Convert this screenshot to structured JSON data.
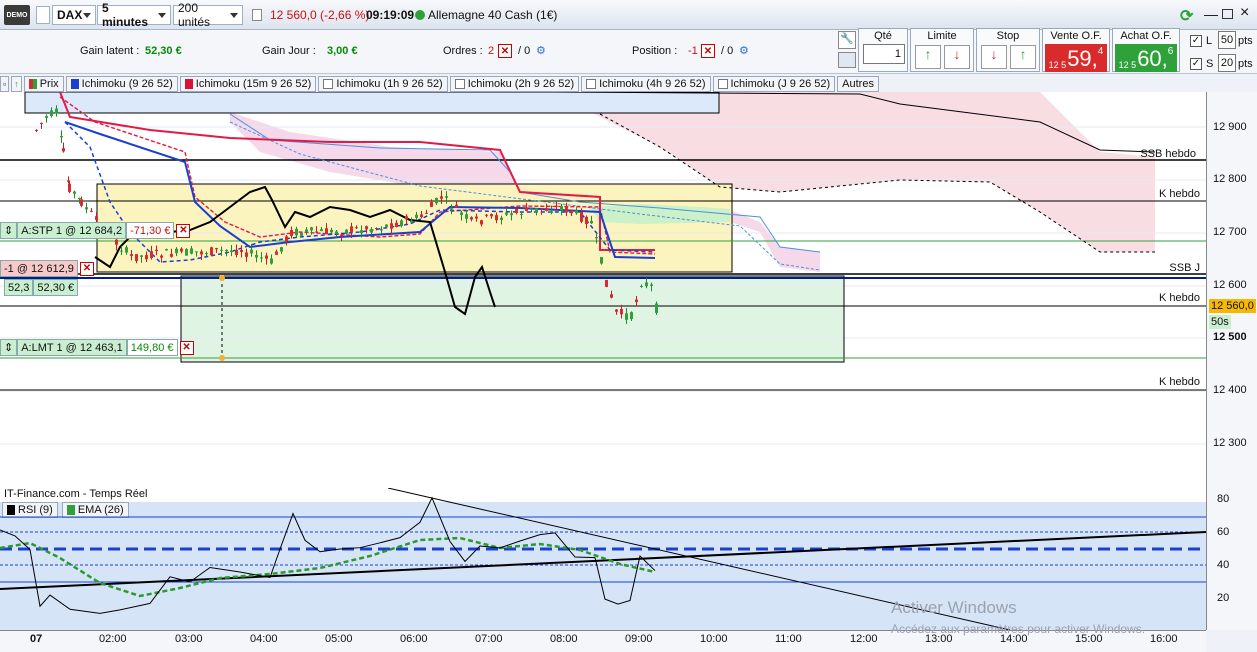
{
  "toolbar": {
    "demo_badge": "DEMO",
    "instrument": "DAX",
    "timeframe": "5 minutes",
    "units": "200 unités",
    "price_change": "12 560,0 (-2,66 %)",
    "time": "09:19:09",
    "market": "Allemagne 40 Cash (1€)"
  },
  "info": {
    "gain_latent_label": "Gain latent :",
    "gain_latent_value": "52,30 €",
    "gain_jour_label": "Gain Jour :",
    "gain_jour_value": "3,00 €",
    "ordres_label": "Ordres :",
    "ordres_count": "2",
    "ordres_zero": "/ 0",
    "position_label": "Position :",
    "position_value": "-1",
    "position_zero": "/ 0"
  },
  "order_panel": {
    "qte_label": "Qté",
    "qte_value": "1",
    "limite_label": "Limite",
    "stop_label": "Stop",
    "vente_label": "Vente O.F.",
    "vente_prefix": "12 5",
    "vente_big": "59,",
    "vente_small": "4",
    "achat_label": "Achat O.F.",
    "achat_prefix": "12 5",
    "achat_big": "60,",
    "achat_small": "6",
    "l_label": "L",
    "l_value": "50",
    "s_label": "S",
    "s_value": "20",
    "pts": "pts",
    "sell_color": "#d92b2b",
    "buy_color": "#2fa13a"
  },
  "legend": {
    "prix": "Prix",
    "items": [
      "Ichimoku (9 26 52)",
      "Ichimoku (15m 9 26 52)",
      "Ichimoku (1h 9 26 52)",
      "Ichimoku (2h 9 26 52)",
      "Ichimoku (4h 9 26 52)",
      "Ichimoku (J 9 26 52)"
    ],
    "autres": "Autres"
  },
  "orders": {
    "stp_label": "A:STP  1 @ 12 684,2",
    "stp_pnl": "-71,30 €",
    "pos_label": "-1 @ 12 612,9",
    "pos_pts": "52,3",
    "pos_pnl": "52,30 €",
    "lmt_label": "A:LMT  1 @ 12 463,1",
    "lmt_pnl": "149,80 €"
  },
  "levels": {
    "ssb_hebdo": "SSB hebdo",
    "k_hebdo_1": "K hebdo",
    "ssb_j": "SSB J",
    "k_hebdo_2": "K hebdo",
    "k_hebdo_3": "K hebdo"
  },
  "price_axis": {
    "ticks": [
      "12 900",
      "12 800",
      "12 700",
      "12 600",
      "12 500",
      "12 400",
      "12 300"
    ],
    "current": "12 560,0",
    "countdown": "50s"
  },
  "rsi": {
    "source": "IT-Finance.com - Temps Réel",
    "rsi_label": "RSI (9)",
    "ema_label": "EMA (26)",
    "ticks": [
      "80",
      "60",
      "40",
      "20"
    ]
  },
  "time_axis": {
    "ticks": [
      "07",
      "02:00",
      "03:00",
      "04:00",
      "05:00",
      "06:00",
      "07:00",
      "08:00",
      "09:00",
      "10:00",
      "11:00",
      "12:00",
      "13:00",
      "14:00",
      "15:00",
      "16:00"
    ]
  },
  "watermark": {
    "title": "Activer Windows",
    "subtitle": "Accédez aux paramètres pour activer Windows."
  }
}
